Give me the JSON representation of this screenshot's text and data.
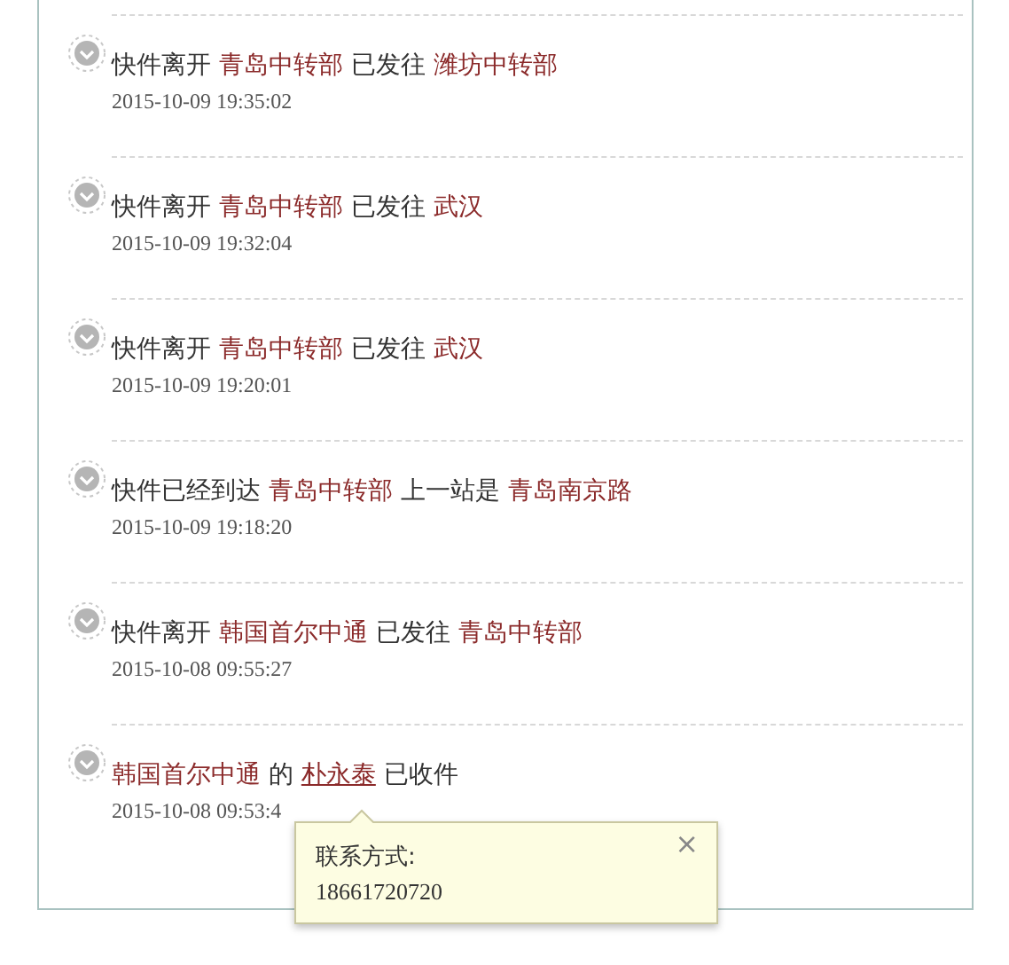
{
  "events": [
    {
      "message": [
        {
          "kind": "plain",
          "text": "快件离开"
        },
        {
          "kind": "place",
          "text": "青岛中转部"
        },
        {
          "kind": "plain",
          "text": "已发往"
        },
        {
          "kind": "place",
          "text": "潍坊中转部"
        }
      ],
      "time": "2015-10-09 19:35:02"
    },
    {
      "message": [
        {
          "kind": "plain",
          "text": "快件离开"
        },
        {
          "kind": "place",
          "text": "青岛中转部"
        },
        {
          "kind": "plain",
          "text": "已发往"
        },
        {
          "kind": "place",
          "text": "武汉"
        }
      ],
      "time": "2015-10-09 19:32:04"
    },
    {
      "message": [
        {
          "kind": "plain",
          "text": "快件离开"
        },
        {
          "kind": "place",
          "text": "青岛中转部"
        },
        {
          "kind": "plain",
          "text": "已发往"
        },
        {
          "kind": "place",
          "text": "武汉"
        }
      ],
      "time": "2015-10-09 19:20:01"
    },
    {
      "message": [
        {
          "kind": "plain",
          "text": "快件已经到达"
        },
        {
          "kind": "place",
          "text": "青岛中转部"
        },
        {
          "kind": "plain",
          "text": "上一站是"
        },
        {
          "kind": "place",
          "text": "青岛南京路"
        }
      ],
      "time": "2015-10-09 19:18:20"
    },
    {
      "message": [
        {
          "kind": "plain",
          "text": "快件离开"
        },
        {
          "kind": "place",
          "text": "韩国首尔中通"
        },
        {
          "kind": "plain",
          "text": "已发往"
        },
        {
          "kind": "place",
          "text": "青岛中转部"
        }
      ],
      "time": "2015-10-08 09:55:27"
    },
    {
      "message": [
        {
          "kind": "place",
          "text": "韩国首尔中通"
        },
        {
          "kind": "plain",
          "text": "的"
        },
        {
          "kind": "person",
          "text": "朴永泰"
        },
        {
          "kind": "plain",
          "text": "已收件"
        }
      ],
      "time": "2015-10-08 09:53:4"
    }
  ],
  "tooltip": {
    "label": "联系方式:",
    "phone": "18661720720",
    "close": "×"
  }
}
